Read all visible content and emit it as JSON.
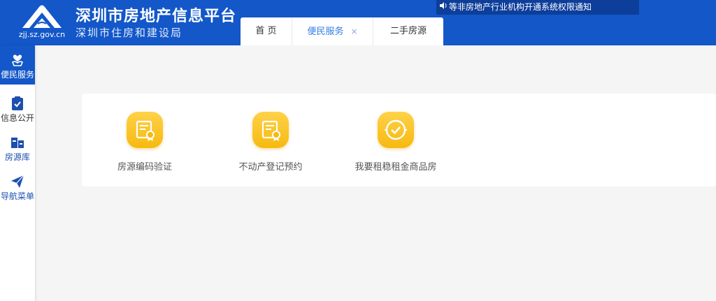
{
  "header": {
    "logo_url": "zjj.sz.gov.cn",
    "title": "深圳市房地产信息平台",
    "subtitle": "深圳市住房和建设局",
    "notice": "等非房地产行业机构开通系统权限通知",
    "bg_color": "#1357c9"
  },
  "tabs": [
    {
      "label": "首 页",
      "active": false
    },
    {
      "label": "便民服务",
      "active": true,
      "close": "×"
    },
    {
      "label": "二手房源",
      "active": false
    }
  ],
  "sidebar": {
    "items": [
      {
        "label": "便民服务",
        "icon": "heart-hand-icon",
        "active": true
      },
      {
        "label": "信息公开",
        "icon": "clipboard-check-icon",
        "active": false
      },
      {
        "label": "房源库",
        "icon": "house-list-icon",
        "active": false
      },
      {
        "label": "导航菜单",
        "icon": "paper-plane-icon",
        "active": false
      }
    ]
  },
  "services": [
    {
      "label": "房源编码验证",
      "icon": "certificate-icon"
    },
    {
      "label": "不动产登记预约",
      "icon": "certificate-icon"
    },
    {
      "label": "我要租稳租金商品房",
      "icon": "check-circle-icon"
    }
  ],
  "colors": {
    "accent": "#1357c9",
    "tab_active": "#2f7de1",
    "service_icon": "#f6b90f"
  }
}
